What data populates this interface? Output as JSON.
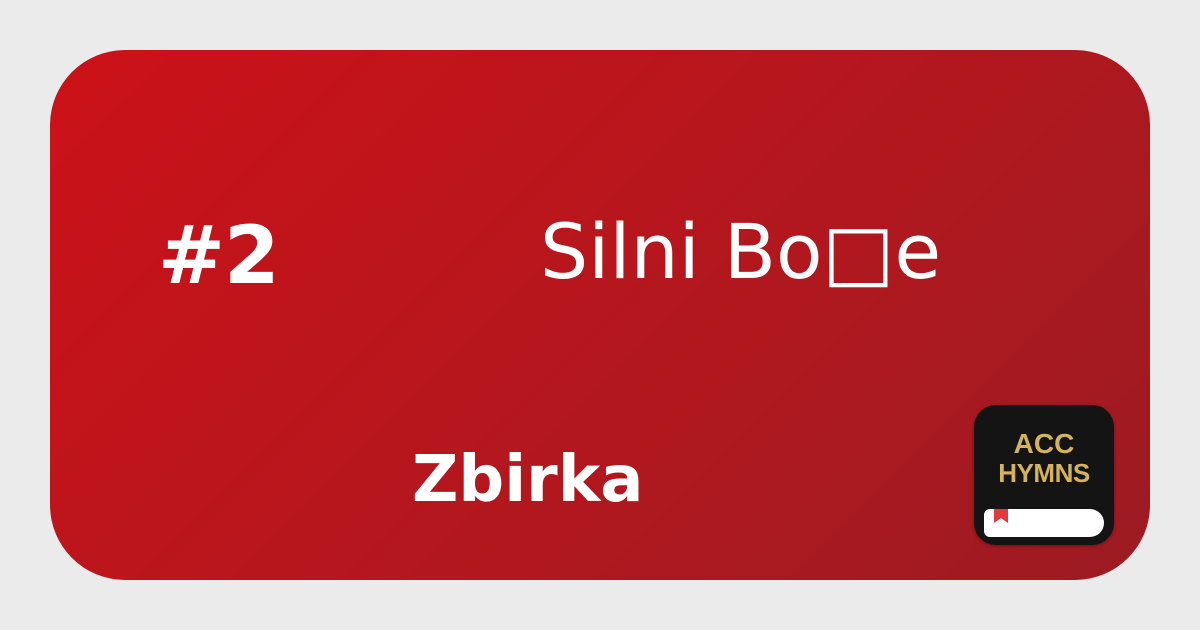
{
  "hymn": {
    "number": "#2",
    "title": "Silni Bo□e",
    "collection": "Zbirka"
  },
  "app_logo": {
    "line1": "ACC",
    "line2": "HYMNS",
    "icon": "book-bookmark-icon"
  },
  "colors": {
    "background": "#ebebeb",
    "card_gradient_start": "#cc1118",
    "card_gradient_end": "#9c1b22",
    "text": "#ffffff",
    "logo_background": "#141414",
    "logo_text": "#d6b25e",
    "bookmark": "#e03a3e"
  }
}
